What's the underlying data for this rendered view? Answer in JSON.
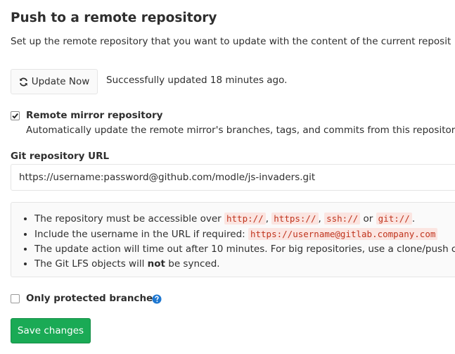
{
  "page": {
    "title": "Push to a remote repository",
    "subtitle": "Set up the remote repository that you want to update with the content of the current reposit"
  },
  "update": {
    "button_label": "Update Now",
    "status": "Successfully updated 18 minutes ago."
  },
  "mirror": {
    "checked": true,
    "label": "Remote mirror repository",
    "help": "Automatically update the remote mirror's branches, tags, and commits from this repositor"
  },
  "url_field": {
    "label": "Git repository URL",
    "value": "https://username:password@github.com/modle/js-invaders.git"
  },
  "info": {
    "item1": {
      "prefix": "The repository must be accessible over ",
      "code1": "http://",
      "sep1": ", ",
      "code2": "https://",
      "sep2": ", ",
      "code3": "ssh://",
      "sep3": " or ",
      "code4": "git://",
      "suffix": "."
    },
    "item2": {
      "prefix": "Include the username in the URL if required: ",
      "code": "https://username@gitlab.company.com"
    },
    "item3": "The update action will time out after 10 minutes. For big repositories, use a clone/push c",
    "item4": {
      "prefix": "The Git LFS objects will ",
      "bold": "not",
      "suffix": " be synced."
    }
  },
  "protected": {
    "checked": false,
    "label": "Only protected branches",
    "icon": "question-circle-icon"
  },
  "save": {
    "label": "Save changes"
  },
  "colors": {
    "primary_button": "#1aaa55",
    "help_icon": "#1f78d1",
    "code_text": "#c0341d"
  }
}
